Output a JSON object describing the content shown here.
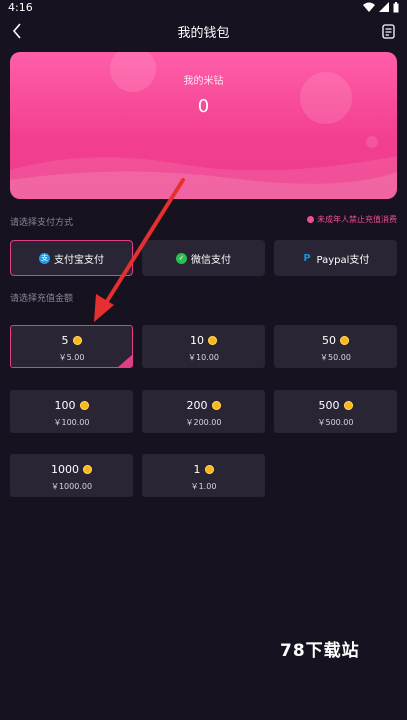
{
  "status": {
    "time": "4:16"
  },
  "header": {
    "title": "我的钱包"
  },
  "balance": {
    "label": "我的米钻",
    "value": "0"
  },
  "payment": {
    "section_label": "请选择支付方式",
    "notice": "未成年人禁止充值消费",
    "methods": [
      {
        "label": "支付宝支付",
        "icon": "alipay-icon",
        "color": "#1f9be8"
      },
      {
        "label": "微信支付",
        "icon": "wechat-pay-icon",
        "color": "#2bbf50"
      },
      {
        "label": "Paypal支付",
        "icon": "paypal-icon",
        "color": "#1a8fd6"
      }
    ]
  },
  "amounts": {
    "section_label": "请选择充值金额",
    "options": [
      {
        "coins": "5",
        "price": "￥5.00"
      },
      {
        "coins": "10",
        "price": "￥10.00"
      },
      {
        "coins": "50",
        "price": "￥50.00"
      },
      {
        "coins": "100",
        "price": "￥100.00"
      },
      {
        "coins": "200",
        "price": "￥200.00"
      },
      {
        "coins": "500",
        "price": "￥500.00"
      },
      {
        "coins": "1000",
        "price": "￥1000.00"
      },
      {
        "coins": "1",
        "price": "￥1.00"
      }
    ]
  },
  "watermark": "78下载站",
  "colors": {
    "accent": "#e03f88",
    "card_bg": "#2a2535",
    "page_bg": "#17121f",
    "coin": "#f6b81d"
  }
}
